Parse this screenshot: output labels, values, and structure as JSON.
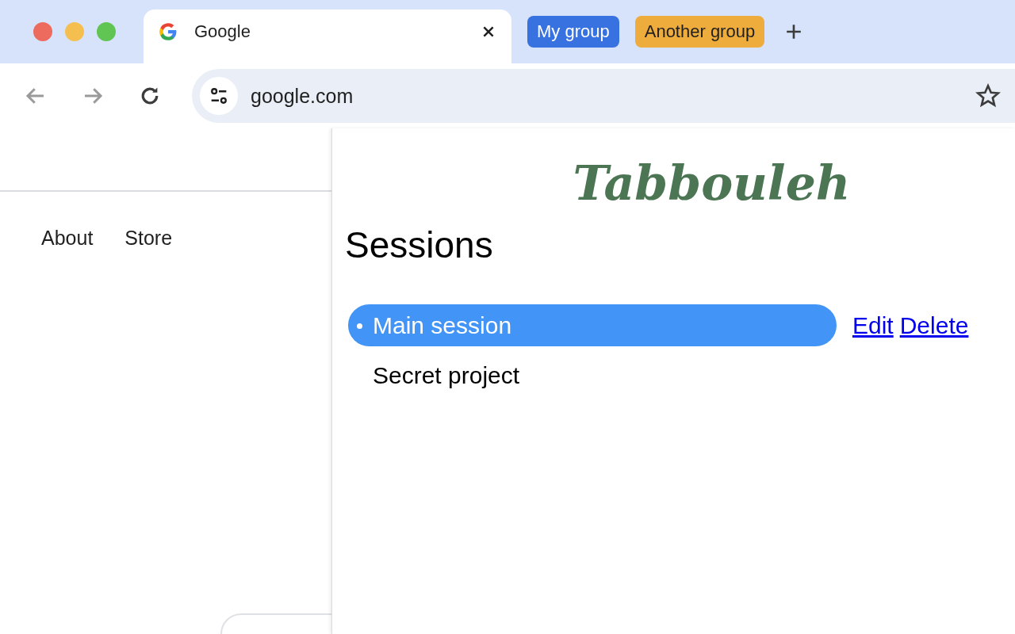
{
  "tab": {
    "title": "Google",
    "active": true
  },
  "tab_groups": [
    {
      "label": "My group",
      "color": "#3871e0"
    },
    {
      "label": "Another group",
      "color": "#eeac3c"
    }
  ],
  "address_bar": {
    "url": "google.com"
  },
  "page": {
    "nav_links": [
      "About",
      "Store"
    ]
  },
  "panel": {
    "logo": "Tabbouleh",
    "heading": "Sessions",
    "sessions": [
      {
        "name": "Main session",
        "selected": true
      },
      {
        "name": "Secret project",
        "selected": false
      }
    ],
    "actions": [
      "Edit",
      "Delete"
    ]
  }
}
